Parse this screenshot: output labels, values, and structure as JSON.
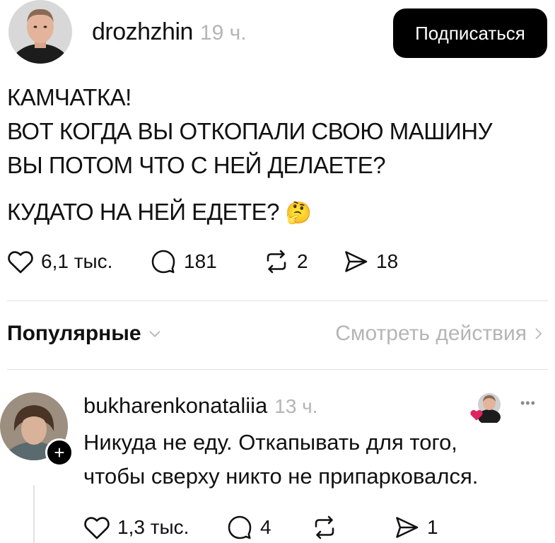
{
  "post": {
    "author": "drozhzhin",
    "time": "19 ч.",
    "follow_label": "Подписаться",
    "lines": [
      "КАМЧАТКА!",
      "ВОТ КОГДА ВЫ ОТКОПАЛИ СВОЮ МАШИНУ",
      "ВЫ ПОТОМ ЧТО С НЕЙ ДЕЛАЕТЕ?",
      "КУДАТО НА НЕЙ ЕДЕТЕ?"
    ],
    "emoji": "🤔",
    "stats": {
      "likes": "6,1 тыс.",
      "comments": "181",
      "reposts": "2",
      "shares": "18"
    }
  },
  "filter": {
    "label": "Популярные",
    "activity_label": "Смотреть действия"
  },
  "comment": {
    "author": "bukharenkonataliia",
    "time": "13 ч.",
    "add_symbol": "+",
    "more_symbol": "•••",
    "lines": [
      "Никуда не еду. Откапывать для того,",
      "чтобы сверху никто не припарковался."
    ],
    "stats": {
      "likes": "1,3 тыс.",
      "comments": "4",
      "reposts": "",
      "shares": "1"
    }
  },
  "colors": {
    "accent": "#000000",
    "muted": "#b5b5b5",
    "divider": "#e2e2e2",
    "heart": "#e0245e"
  }
}
